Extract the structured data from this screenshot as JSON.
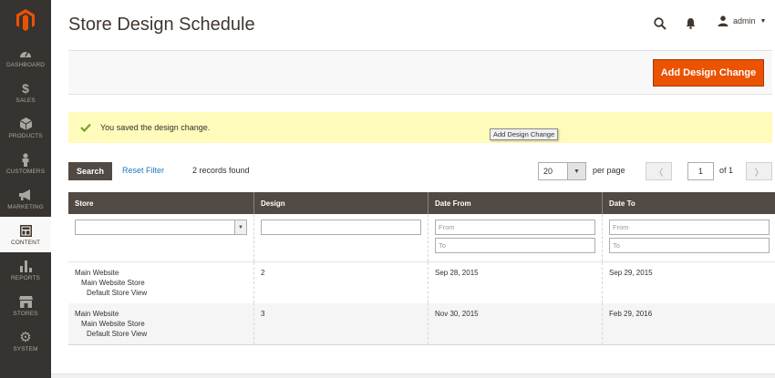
{
  "sidebar": {
    "items": [
      {
        "label": "DASHBOARD",
        "icon": "dashboard-icon"
      },
      {
        "label": "SALES",
        "icon": "dollar-icon"
      },
      {
        "label": "PRODUCTS",
        "icon": "cube-icon"
      },
      {
        "label": "CUSTOMERS",
        "icon": "person-icon"
      },
      {
        "label": "MARKETING",
        "icon": "megaphone-icon"
      },
      {
        "label": "CONTENT",
        "icon": "layout-icon"
      },
      {
        "label": "REPORTS",
        "icon": "bar-chart-icon"
      },
      {
        "label": "STORES",
        "icon": "storefront-icon"
      },
      {
        "label": "SYSTEM",
        "icon": "gear-icon"
      }
    ],
    "active": "CONTENT"
  },
  "header": {
    "title": "Store Design Schedule",
    "user": "admin"
  },
  "actions": {
    "add_label": "Add Design Change"
  },
  "message": {
    "text": "You saved the design change.",
    "tooltip": "Add Design Change"
  },
  "grid_controls": {
    "search_label": "Search",
    "reset_label": "Reset Filter",
    "records": "2 records found",
    "per_page_value": "20",
    "per_page_label": "per page",
    "page": "1",
    "of_pages": "of 1"
  },
  "table": {
    "columns": [
      "Store",
      "Design",
      "Date From",
      "Date To"
    ],
    "filters": {
      "date_from_placeholder": "From",
      "date_to_placeholder": "To"
    },
    "rows": [
      {
        "website": "Main Website",
        "store": "Main Website Store",
        "view": "Default Store View",
        "design": "2",
        "date_from": "Sep 28, 2015",
        "date_to": "Sep 29, 2015"
      },
      {
        "website": "Main Website",
        "store": "Main Website Store",
        "view": "Default Store View",
        "design": "3",
        "date_from": "Nov 30, 2015",
        "date_to": "Feb 29, 2016"
      }
    ]
  },
  "colors": {
    "accent": "#eb5202",
    "sidebar": "#373330",
    "table_header": "#514943",
    "message_bg": "#fffbbb",
    "link": "#1979c3"
  }
}
